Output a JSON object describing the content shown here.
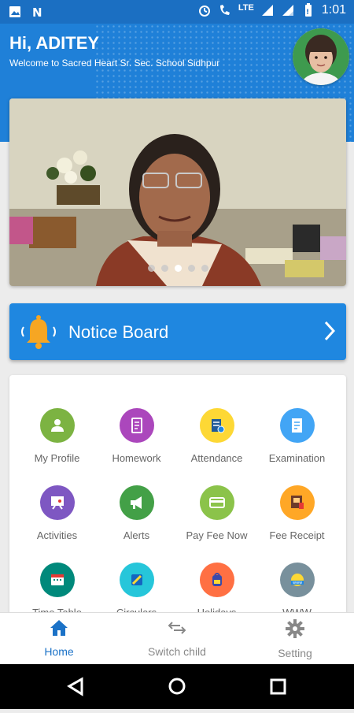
{
  "status": {
    "network": "LTE",
    "time": "1:01"
  },
  "header": {
    "greeting": "Hi, ADITEY",
    "welcome": "Welcome to Sacred Heart Sr. Sec. School Sidhpur"
  },
  "carousel": {
    "slide_count": 5,
    "active_index": 2
  },
  "notice_board": {
    "label": "Notice Board"
  },
  "menu": [
    {
      "label": "My Profile",
      "icon": "person-icon",
      "color": "#7cb342"
    },
    {
      "label": "Homework",
      "icon": "notebook-icon",
      "color": "#ab47bc"
    },
    {
      "label": "Attendance",
      "icon": "attendance-icon",
      "color": "#fdd835"
    },
    {
      "label": "Examination",
      "icon": "exam-icon",
      "color": "#42a5f5"
    },
    {
      "label": "Activities",
      "icon": "activities-icon",
      "color": "#7e57c2"
    },
    {
      "label": "Alerts",
      "icon": "megaphone-icon",
      "color": "#43a047"
    },
    {
      "label": "Pay Fee Now",
      "icon": "card-icon",
      "color": "#8bc34a"
    },
    {
      "label": "Fee Receipt",
      "icon": "receipt-icon",
      "color": "#ffa726"
    },
    {
      "label": "Time Table",
      "icon": "calendar-icon",
      "color": "#00897b"
    },
    {
      "label": "Circulars",
      "icon": "pen-icon",
      "color": "#26c6da"
    },
    {
      "label": "Holidays",
      "icon": "bag-icon",
      "color": "#ff7043"
    },
    {
      "label": "WWW",
      "icon": "globe-icon",
      "color": "#78909c"
    }
  ],
  "bottom_nav": {
    "home": "Home",
    "switch_child": "Switch child",
    "setting": "Setting",
    "active_color": "#1b72c7"
  }
}
